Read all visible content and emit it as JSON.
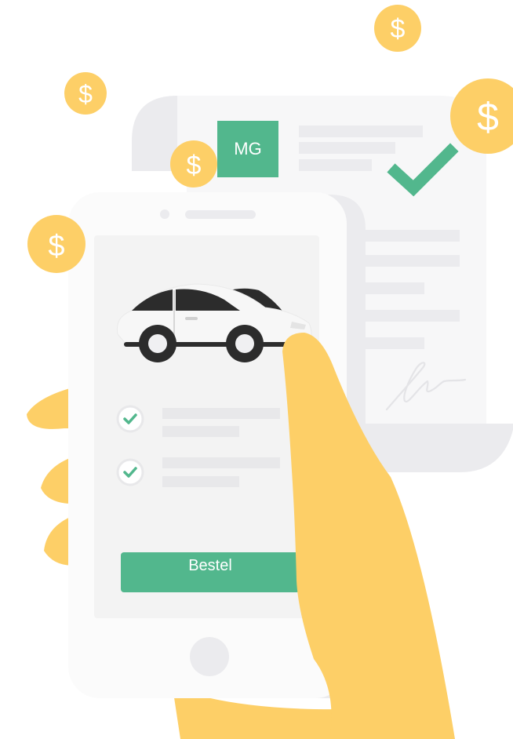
{
  "brand": {
    "logo_text": "MG"
  },
  "coins": {
    "symbol": "$"
  },
  "phone": {
    "order_button_label": "Bestel",
    "checklist_count": 2
  },
  "colors": {
    "accent_green": "#52b78d",
    "coin_yellow": "#fdcf67",
    "hand_yellow": "#fdcf67",
    "document_gray": "#ebebee",
    "phone_white": "#fbfbfb",
    "screen_gray": "#f3f3f3",
    "placeholder_gray": "#e8e8ea",
    "car_dark": "#2c2c2c"
  },
  "icons": {
    "document_check": "checkmark-icon",
    "list_check": "check-circle-icon",
    "signature": "signature-icon",
    "car": "car-icon",
    "coin": "dollar-coin-icon"
  }
}
